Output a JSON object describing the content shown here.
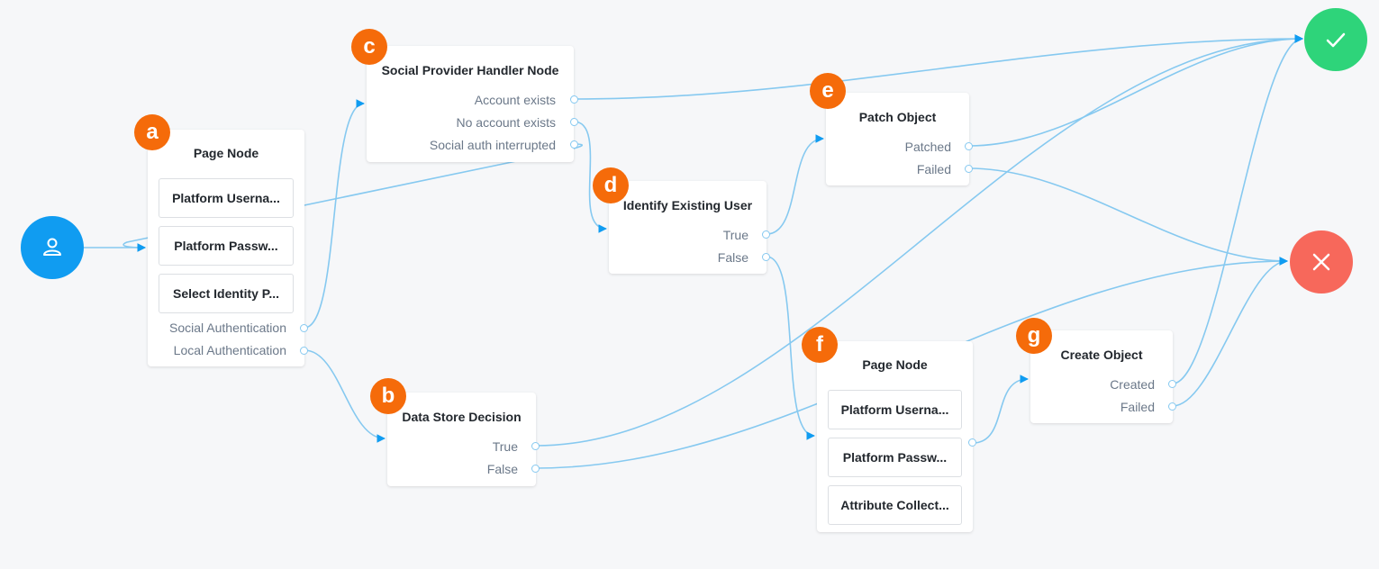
{
  "canvas": {
    "edge_color": "#86c9f0",
    "arrow_color": "#109cf1"
  },
  "start": {
    "icon": "user-icon",
    "color": "#109cf1"
  },
  "success": {
    "icon": "check-icon",
    "color": "#2ed47a"
  },
  "failure": {
    "icon": "close-icon",
    "color": "#f7685b"
  },
  "badge_color": "#f56b0a",
  "nodes": [
    {
      "id": "a",
      "badge": "a",
      "title": "Page Node",
      "children": [
        "Platform Userna...",
        "Platform Passw...",
        "Select Identity P..."
      ],
      "outcomes": [
        "Social Authentication",
        "Local Authentication"
      ]
    },
    {
      "id": "b",
      "badge": "b",
      "title": "Data Store Decision",
      "children": [],
      "outcomes": [
        "True",
        "False"
      ]
    },
    {
      "id": "c",
      "badge": "c",
      "title": "Social Provider Handler Node",
      "children": [],
      "outcomes": [
        "Account exists",
        "No account exists",
        "Social auth interrupted"
      ]
    },
    {
      "id": "d",
      "badge": "d",
      "title": "Identify Existing User",
      "children": [],
      "outcomes": [
        "True",
        "False"
      ]
    },
    {
      "id": "e",
      "badge": "e",
      "title": "Patch Object",
      "children": [],
      "outcomes": [
        "Patched",
        "Failed"
      ]
    },
    {
      "id": "f",
      "badge": "f",
      "title": "Page Node",
      "children": [
        "Platform Userna...",
        "Platform Passw...",
        "Attribute Collect..."
      ],
      "outcomes": []
    },
    {
      "id": "g",
      "badge": "g",
      "title": "Create Object",
      "children": [],
      "outcomes": [
        "Created",
        "Failed"
      ]
    }
  ],
  "connections": [
    {
      "from": "start",
      "to": "a"
    },
    {
      "from": "a:Social Authentication",
      "to": "c"
    },
    {
      "from": "a:Local Authentication",
      "to": "b"
    },
    {
      "from": "c:Account exists",
      "to": "success"
    },
    {
      "from": "c:No account exists",
      "to": "d"
    },
    {
      "from": "c:Social auth interrupted",
      "to": "a"
    },
    {
      "from": "d:True",
      "to": "e"
    },
    {
      "from": "d:False",
      "to": "f"
    },
    {
      "from": "e:Patched",
      "to": "success"
    },
    {
      "from": "e:Failed",
      "to": "failure"
    },
    {
      "from": "b:True",
      "to": "success"
    },
    {
      "from": "b:False",
      "to": "failure"
    },
    {
      "from": "f:out",
      "to": "g"
    },
    {
      "from": "g:Created",
      "to": "success"
    },
    {
      "from": "g:Failed",
      "to": "failure"
    }
  ]
}
